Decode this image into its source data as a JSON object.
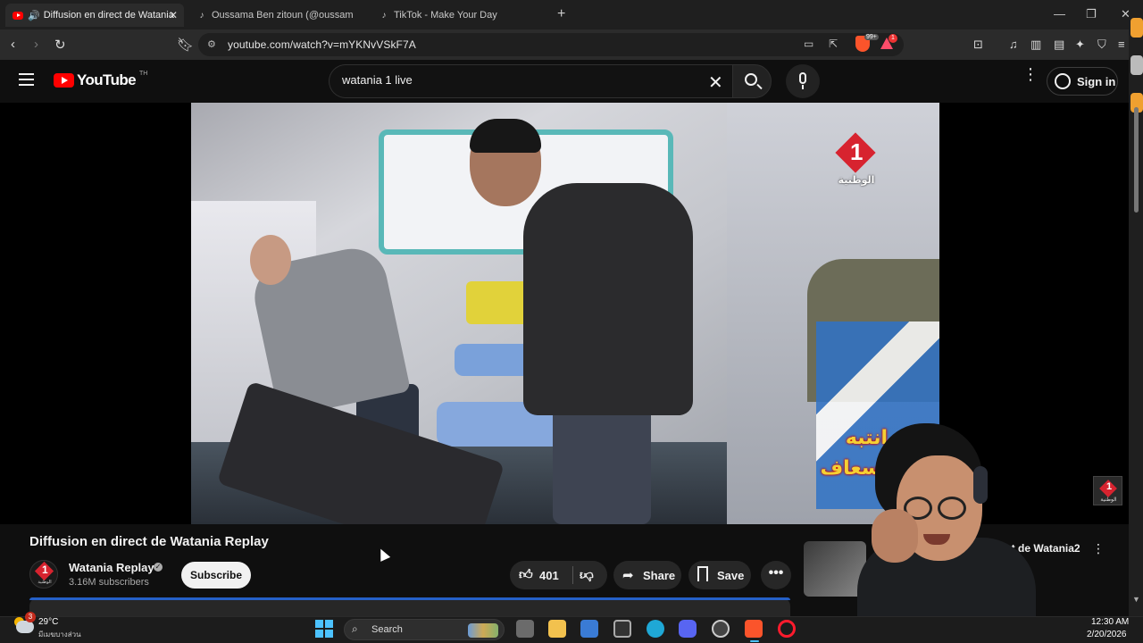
{
  "browser": {
    "tabs": [
      {
        "title": "Diffusion en direct de Watania",
        "active": true
      },
      {
        "title": "Oussama Ben zitoun (@oussama.ben",
        "active": false
      },
      {
        "title": "TikTok - Make Your Day",
        "active": false
      }
    ],
    "url": "youtube.com/watch?v=mYKNvVSkF7A",
    "shield_badge": "99+",
    "rewards_badge": "1"
  },
  "youtube": {
    "logo_text": "YouTube",
    "country_code": "TH",
    "search_value": "watania 1 live",
    "search_placeholder": "Search",
    "signin_label": "Sign in"
  },
  "video": {
    "channel_bug_number": "1",
    "channel_bug_arabic": "الوطنية",
    "overlay_line1": "انتبه",
    "overlay_line2": "إسعاف",
    "title": "Diffusion en direct de Watania Replay",
    "channel_name": "Watania Replay",
    "subscribers": "3.16M subscribers",
    "subscribe_label": "Subscribe",
    "like_count": "401",
    "share_label": "Share",
    "save_label": "Save",
    "more_label": "•••"
  },
  "recommendation": {
    "title": "ct de Watania2"
  },
  "taskbar": {
    "weather_badge": "3",
    "temperature": "29°C",
    "location": "มีเมฆบางส่วน",
    "search_label": "Search",
    "time": "12:30 AM",
    "date": "2/20/2026"
  },
  "colors": {
    "youtube_red": "#ff0000",
    "watania_red": "#d7232f",
    "background": "#0f0f0f"
  }
}
